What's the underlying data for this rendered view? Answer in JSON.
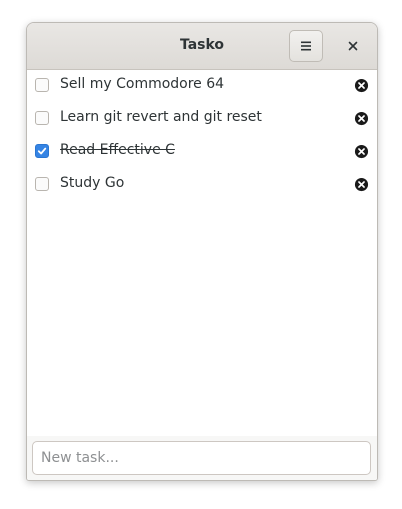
{
  "window": {
    "title": "Tasko",
    "menu_icon": "hamburger-menu-icon",
    "close_icon": "close-icon"
  },
  "tasks": [
    {
      "label": "Sell my Commodore 64",
      "done": false
    },
    {
      "label": "Learn git revert and git reset",
      "done": false
    },
    {
      "label": "Read Effective C",
      "done": true
    },
    {
      "label": "Study Go",
      "done": false
    }
  ],
  "new_task": {
    "placeholder": "New task...",
    "value": ""
  },
  "colors": {
    "accent": "#3584e4",
    "text": "#2e3436",
    "delete_icon": "#1a1a1a"
  }
}
